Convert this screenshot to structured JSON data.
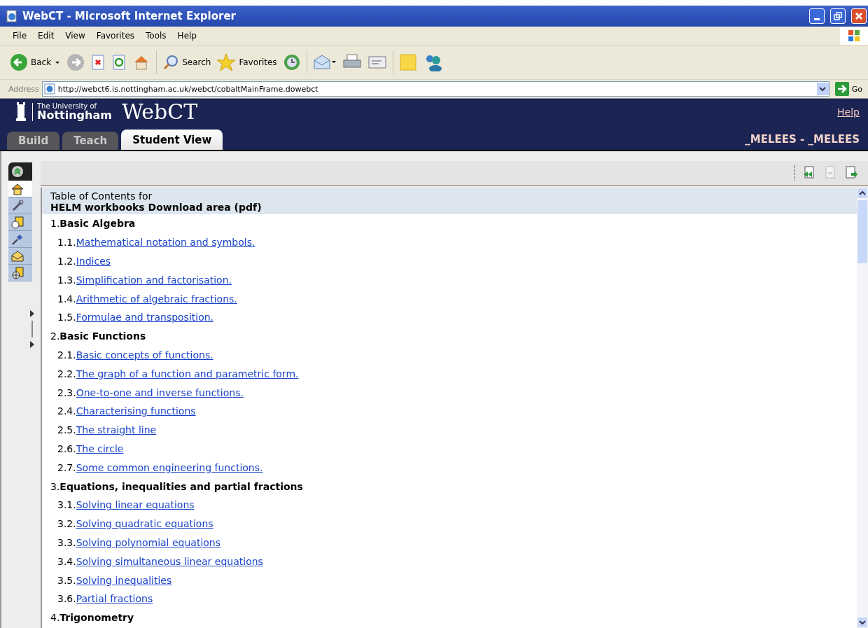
{
  "window": {
    "title": "WebCT - Microsoft Internet Explorer"
  },
  "menu": [
    "File",
    "Edit",
    "View",
    "Favorites",
    "Tools",
    "Help"
  ],
  "toolbar": {
    "back": "Back",
    "search": "Search",
    "favorites": "Favorites"
  },
  "address": {
    "label": "Address",
    "url": "http://webct6.is.nottingham.ac.uk/webct/cobaltMainFrame.dowebct",
    "go": "Go"
  },
  "header": {
    "university_line1": "The University of",
    "university_line2": "Nottingham",
    "product": "WebCT",
    "help": "Help",
    "user": "_MELEES - _MELEES"
  },
  "tabs": [
    {
      "label": "Build",
      "selected": false
    },
    {
      "label": "Teach",
      "selected": false
    },
    {
      "label": "Student View",
      "selected": true
    }
  ],
  "toc": {
    "heading": "Table of Contents for",
    "course": "HELM workbooks Download area (pdf)",
    "sections": [
      {
        "number": "1.",
        "title": "Basic Algebra",
        "items": [
          {
            "number": "1.1.",
            "title": "Mathematical notation and symbols."
          },
          {
            "number": "1.2.",
            "title": "Indices"
          },
          {
            "number": "1.3.",
            "title": "Simplification and factorisation."
          },
          {
            "number": "1.4.",
            "title": "Arithmetic of algebraic fractions."
          },
          {
            "number": "1.5.",
            "title": "Formulae and transposition."
          }
        ]
      },
      {
        "number": "2.",
        "title": "Basic Functions",
        "items": [
          {
            "number": "2.1.",
            "title": "Basic concepts of functions."
          },
          {
            "number": "2.2.",
            "title": "The graph of a function and parametric form."
          },
          {
            "number": "2.3.",
            "title": "One-to-one and inverse functions."
          },
          {
            "number": "2.4.",
            "title": "Characterising functions"
          },
          {
            "number": "2.5.",
            "title": "The straight line"
          },
          {
            "number": "2.6.",
            "title": "The circle"
          },
          {
            "number": "2.7.",
            "title": "Some common engineering functions."
          }
        ]
      },
      {
        "number": "3.",
        "title": "Equations, inequalities and partial fractions",
        "items": [
          {
            "number": "3.1.",
            "title": "Solving linear equations"
          },
          {
            "number": "3.2.",
            "title": "Solving quadratic equations"
          },
          {
            "number": "3.3.",
            "title": "Solving polynomial equations"
          },
          {
            "number": "3.4.",
            "title": "Solving simultaneous linear equations"
          },
          {
            "number": "3.5.",
            "title": "Solving inequalities"
          },
          {
            "number": "3.6.",
            "title": "Partial fractions"
          }
        ]
      },
      {
        "number": "4.",
        "title": "Trigonometry"
      }
    ]
  }
}
